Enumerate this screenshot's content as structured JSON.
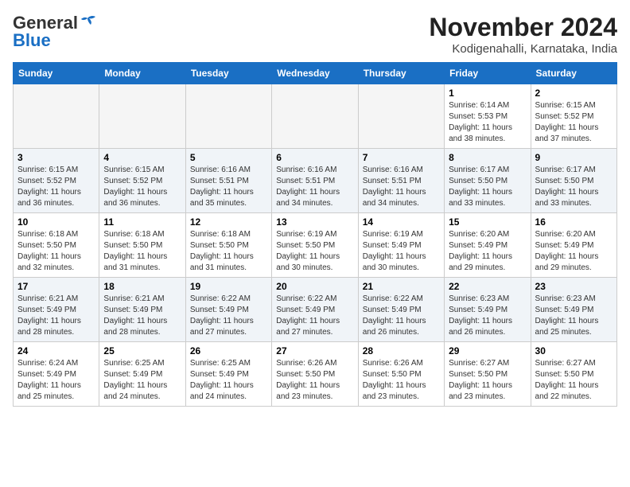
{
  "header": {
    "logo_general": "General",
    "logo_blue": "Blue",
    "month_title": "November 2024",
    "subtitle": "Kodigenahalli, Karnataka, India"
  },
  "days_of_week": [
    "Sunday",
    "Monday",
    "Tuesday",
    "Wednesday",
    "Thursday",
    "Friday",
    "Saturday"
  ],
  "weeks": [
    [
      {
        "day": "",
        "info": ""
      },
      {
        "day": "",
        "info": ""
      },
      {
        "day": "",
        "info": ""
      },
      {
        "day": "",
        "info": ""
      },
      {
        "day": "",
        "info": ""
      },
      {
        "day": "1",
        "info": "Sunrise: 6:14 AM\nSunset: 5:53 PM\nDaylight: 11 hours\nand 38 minutes."
      },
      {
        "day": "2",
        "info": "Sunrise: 6:15 AM\nSunset: 5:52 PM\nDaylight: 11 hours\nand 37 minutes."
      }
    ],
    [
      {
        "day": "3",
        "info": "Sunrise: 6:15 AM\nSunset: 5:52 PM\nDaylight: 11 hours\nand 36 minutes."
      },
      {
        "day": "4",
        "info": "Sunrise: 6:15 AM\nSunset: 5:52 PM\nDaylight: 11 hours\nand 36 minutes."
      },
      {
        "day": "5",
        "info": "Sunrise: 6:16 AM\nSunset: 5:51 PM\nDaylight: 11 hours\nand 35 minutes."
      },
      {
        "day": "6",
        "info": "Sunrise: 6:16 AM\nSunset: 5:51 PM\nDaylight: 11 hours\nand 34 minutes."
      },
      {
        "day": "7",
        "info": "Sunrise: 6:16 AM\nSunset: 5:51 PM\nDaylight: 11 hours\nand 34 minutes."
      },
      {
        "day": "8",
        "info": "Sunrise: 6:17 AM\nSunset: 5:50 PM\nDaylight: 11 hours\nand 33 minutes."
      },
      {
        "day": "9",
        "info": "Sunrise: 6:17 AM\nSunset: 5:50 PM\nDaylight: 11 hours\nand 33 minutes."
      }
    ],
    [
      {
        "day": "10",
        "info": "Sunrise: 6:18 AM\nSunset: 5:50 PM\nDaylight: 11 hours\nand 32 minutes."
      },
      {
        "day": "11",
        "info": "Sunrise: 6:18 AM\nSunset: 5:50 PM\nDaylight: 11 hours\nand 31 minutes."
      },
      {
        "day": "12",
        "info": "Sunrise: 6:18 AM\nSunset: 5:50 PM\nDaylight: 11 hours\nand 31 minutes."
      },
      {
        "day": "13",
        "info": "Sunrise: 6:19 AM\nSunset: 5:50 PM\nDaylight: 11 hours\nand 30 minutes."
      },
      {
        "day": "14",
        "info": "Sunrise: 6:19 AM\nSunset: 5:49 PM\nDaylight: 11 hours\nand 30 minutes."
      },
      {
        "day": "15",
        "info": "Sunrise: 6:20 AM\nSunset: 5:49 PM\nDaylight: 11 hours\nand 29 minutes."
      },
      {
        "day": "16",
        "info": "Sunrise: 6:20 AM\nSunset: 5:49 PM\nDaylight: 11 hours\nand 29 minutes."
      }
    ],
    [
      {
        "day": "17",
        "info": "Sunrise: 6:21 AM\nSunset: 5:49 PM\nDaylight: 11 hours\nand 28 minutes."
      },
      {
        "day": "18",
        "info": "Sunrise: 6:21 AM\nSunset: 5:49 PM\nDaylight: 11 hours\nand 28 minutes."
      },
      {
        "day": "19",
        "info": "Sunrise: 6:22 AM\nSunset: 5:49 PM\nDaylight: 11 hours\nand 27 minutes."
      },
      {
        "day": "20",
        "info": "Sunrise: 6:22 AM\nSunset: 5:49 PM\nDaylight: 11 hours\nand 27 minutes."
      },
      {
        "day": "21",
        "info": "Sunrise: 6:22 AM\nSunset: 5:49 PM\nDaylight: 11 hours\nand 26 minutes."
      },
      {
        "day": "22",
        "info": "Sunrise: 6:23 AM\nSunset: 5:49 PM\nDaylight: 11 hours\nand 26 minutes."
      },
      {
        "day": "23",
        "info": "Sunrise: 6:23 AM\nSunset: 5:49 PM\nDaylight: 11 hours\nand 25 minutes."
      }
    ],
    [
      {
        "day": "24",
        "info": "Sunrise: 6:24 AM\nSunset: 5:49 PM\nDaylight: 11 hours\nand 25 minutes."
      },
      {
        "day": "25",
        "info": "Sunrise: 6:25 AM\nSunset: 5:49 PM\nDaylight: 11 hours\nand 24 minutes."
      },
      {
        "day": "26",
        "info": "Sunrise: 6:25 AM\nSunset: 5:49 PM\nDaylight: 11 hours\nand 24 minutes."
      },
      {
        "day": "27",
        "info": "Sunrise: 6:26 AM\nSunset: 5:50 PM\nDaylight: 11 hours\nand 23 minutes."
      },
      {
        "day": "28",
        "info": "Sunrise: 6:26 AM\nSunset: 5:50 PM\nDaylight: 11 hours\nand 23 minutes."
      },
      {
        "day": "29",
        "info": "Sunrise: 6:27 AM\nSunset: 5:50 PM\nDaylight: 11 hours\nand 23 minutes."
      },
      {
        "day": "30",
        "info": "Sunrise: 6:27 AM\nSunset: 5:50 PM\nDaylight: 11 hours\nand 22 minutes."
      }
    ]
  ]
}
